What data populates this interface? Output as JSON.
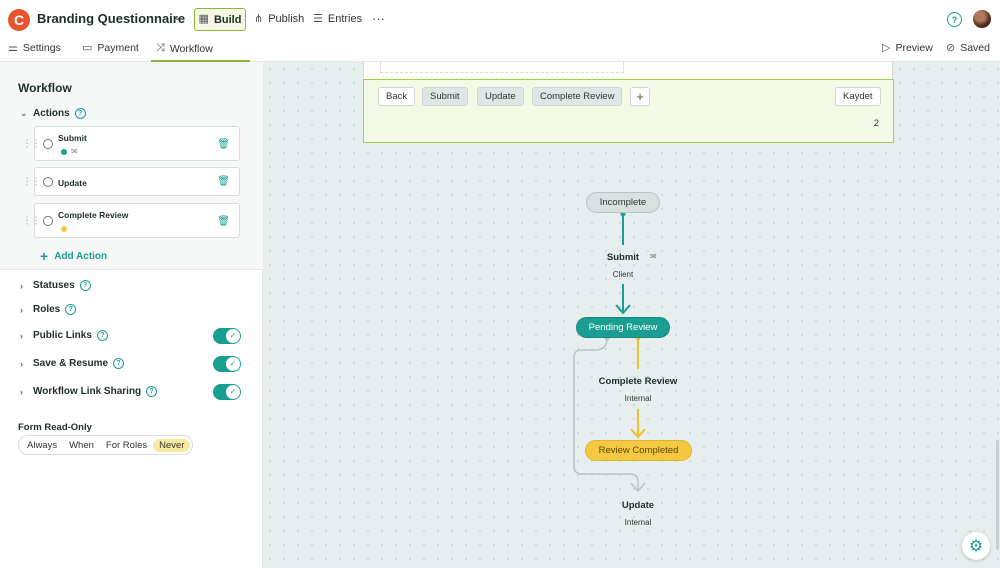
{
  "header": {
    "app_title": "Branding Questionnaire",
    "build_label": "Build",
    "publish_label": "Publish",
    "entries_label": "Entries",
    "more_label": "···"
  },
  "subnav": {
    "settings_label": "Settings",
    "payment_label": "Payment",
    "workflow_label": "Workflow",
    "preview_label": "Preview",
    "saved_label": "Saved"
  },
  "sidebar": {
    "title": "Workflow",
    "actions_label": "Actions",
    "actions": [
      {
        "name": "Submit"
      },
      {
        "name": "Update"
      },
      {
        "name": "Complete Review"
      }
    ],
    "add_action_label": "Add Action",
    "sections": [
      {
        "label": "Statuses",
        "toggle": null
      },
      {
        "label": "Roles",
        "toggle": null
      },
      {
        "label": "Public Links",
        "toggle": true
      },
      {
        "label": "Save & Resume",
        "toggle": true
      },
      {
        "label": "Workflow Link Sharing",
        "toggle": true
      }
    ],
    "read_only_label": "Form Read-Only",
    "read_only_options": [
      "Always",
      "When",
      "For Roles",
      "Never"
    ],
    "read_only_selected": "Never"
  },
  "form_bar": {
    "buttons": [
      "Back",
      "Submit",
      "Update",
      "Complete Review"
    ],
    "save_label": "Kaydet",
    "page_number": "2"
  },
  "workflow": {
    "status_incomplete": "Incomplete",
    "action_submit": "Submit",
    "submit_role": "Client",
    "status_pending": "Pending Review",
    "action_complete_review": "Complete Review",
    "complete_review_role": "Internal",
    "status_completed": "Review Completed",
    "action_update": "Update",
    "update_role": "Internal"
  },
  "colors": {
    "accent_teal": "#1a9e92",
    "accent_green": "#8fb43a",
    "status_yellow": "#f5c842",
    "logo_orange": "#e8542b"
  }
}
